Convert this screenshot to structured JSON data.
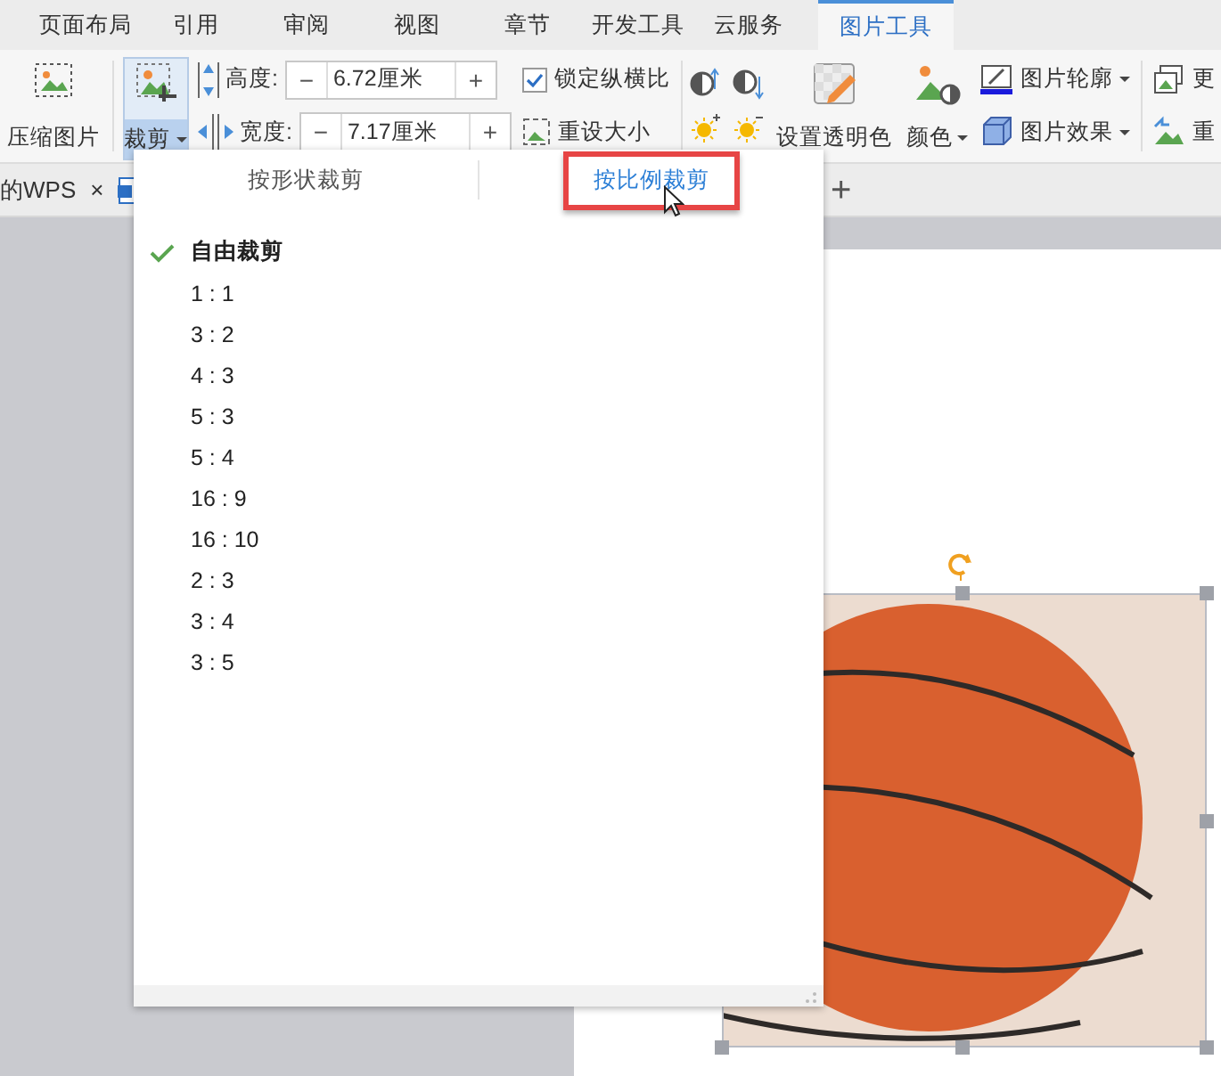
{
  "menu_tabs": [
    {
      "label": "页面布局",
      "selected": false
    },
    {
      "label": "引用",
      "selected": false
    },
    {
      "label": "审阅",
      "selected": false
    },
    {
      "label": "视图",
      "selected": false
    },
    {
      "label": "章节",
      "selected": false
    },
    {
      "label": "开发工具",
      "selected": false
    },
    {
      "label": "云服务",
      "selected": false
    },
    {
      "label": "图片工具",
      "selected": true
    }
  ],
  "ribbon": {
    "compress_button": "压缩图片",
    "crop_button": {
      "label": "裁剪",
      "active": true
    },
    "height": {
      "label": "高度:",
      "value": "6.72厘米",
      "minus": "−",
      "plus": "+"
    },
    "width": {
      "label": "宽度:",
      "value": "7.17厘米",
      "minus": "−",
      "plus": "+"
    },
    "lock_ratio": {
      "label": "锁定纵横比",
      "checked": true
    },
    "reset_size": "重设大小",
    "transparent_color": "设置透明色",
    "color_button": "颜色",
    "outline": "图片轮廓",
    "effects": "图片效果",
    "change_picture": "更",
    "reset_picture": "重"
  },
  "document_tabs": [
    {
      "label": "的WPS",
      "close": "×"
    }
  ],
  "new_tab": "+",
  "crop_menu": {
    "tabs": [
      {
        "label": "按形状裁剪",
        "selected": false
      },
      {
        "label": "按比例裁剪",
        "selected": true
      }
    ],
    "items": [
      {
        "label": "自由裁剪",
        "checked": true
      },
      {
        "label": "1 : 1",
        "checked": false
      },
      {
        "label": "3 : 2",
        "checked": false
      },
      {
        "label": "4 : 3",
        "checked": false
      },
      {
        "label": "5 : 3",
        "checked": false
      },
      {
        "label": "5 : 4",
        "checked": false
      },
      {
        "label": "16 : 9",
        "checked": false
      },
      {
        "label": "16 : 10",
        "checked": false
      },
      {
        "label": "2 : 3",
        "checked": false
      },
      {
        "label": "3 : 4",
        "checked": false
      },
      {
        "label": "3 : 5",
        "checked": false
      }
    ]
  }
}
